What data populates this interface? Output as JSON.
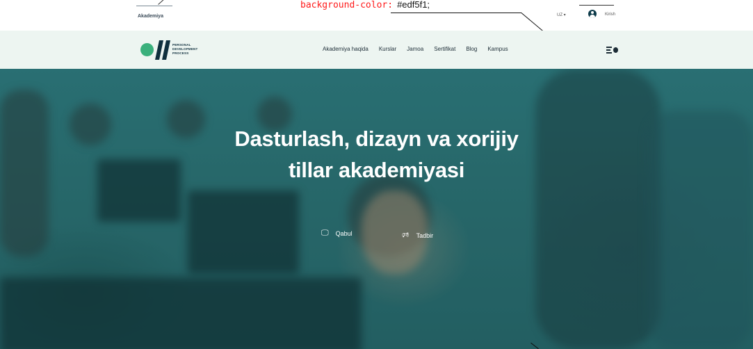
{
  "annotation": {
    "section_label": "Akademiya",
    "css_property": "background-color:",
    "css_value": "#edf5f1;"
  },
  "topbar": {
    "language": "UZ ▾",
    "login": "Kirish"
  },
  "header": {
    "background": "#edf5f1",
    "logo": {
      "line1": "PERSONAL",
      "line2": "DEVELOPMENT",
      "line3": "PROCESS",
      "circle_color": "#3ab07c",
      "slash_color": "#0f2f3d"
    },
    "nav": [
      "Akademiya haqida",
      "Kurslar",
      "Jamoa",
      "Sertifikat",
      "Blog",
      "Kampus"
    ]
  },
  "hero": {
    "title_line1": "Dasturlash, dizayn va xorijiy",
    "title_line2": "tillar akademiyasi",
    "buttons": [
      {
        "label": "Qabul",
        "icon": "laptop-icon"
      },
      {
        "label": "Tadbir",
        "icon": "megaphone-icon"
      }
    ],
    "overlay_color": "#2a6568"
  }
}
